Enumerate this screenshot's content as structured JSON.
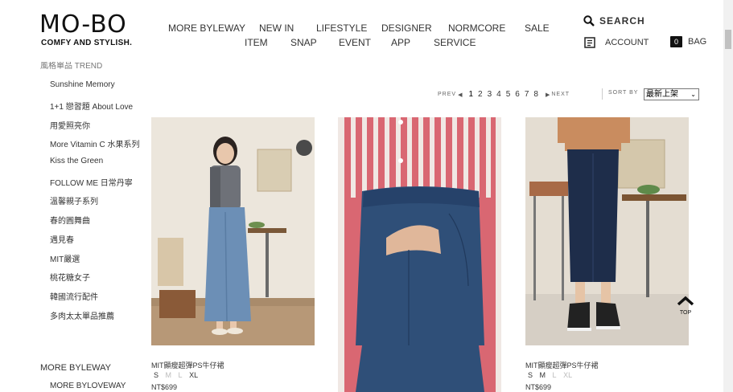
{
  "brand": {
    "logo": "MO-BO",
    "tagline": "COMFY AND STYLISH."
  },
  "nav": {
    "row1": [
      "MORE BYLEWAY",
      "NEW IN",
      "LIFESTYLE",
      "DESIGNER",
      "NORMCORE",
      "SALE"
    ],
    "row2": [
      "ITEM",
      "SNAP",
      "EVENT",
      "APP",
      "SERVICE"
    ]
  },
  "utility": {
    "search": "SEARCH",
    "account": "ACCOUNT",
    "bag": "BAG",
    "bag_count": "0"
  },
  "sidebar": {
    "heading": "風格單品 TREND",
    "items": [
      "Sunshine Memory",
      "1+1 戀習題 About Love",
      "用愛照亮你",
      "More Vitamin C 水果系列",
      "Kiss the Green",
      "FOLLOW ME 日常丹寧",
      "溫馨親子系列",
      "春的圓舞曲",
      "遇見春",
      "MIT嚴選",
      "桃花糖女子",
      "韓國流行配件",
      "多肉太太單品推薦"
    ],
    "section2_title": "MORE BYLEWAY",
    "section2_item": "MORE BYLOVEWAY"
  },
  "pager": {
    "prev": "PREV",
    "next": "NEXT",
    "pages": [
      "1",
      "2",
      "3",
      "4",
      "5",
      "6",
      "7",
      "8"
    ],
    "current": "1"
  },
  "sort": {
    "label": "SORT BY",
    "value": "最新上架"
  },
  "products": [
    {
      "name": "MIT顯瘦超彈PS牛仔裙",
      "sizes": [
        {
          "s": "S",
          "avail": true
        },
        {
          "s": "M",
          "avail": false
        },
        {
          "s": "L",
          "avail": false
        },
        {
          "s": "XL",
          "avail": true
        }
      ],
      "price": "NT$699"
    },
    {
      "name": "",
      "sizes": [],
      "price": ""
    },
    {
      "name": "MIT顯瘦超彈PS牛仔裙",
      "sizes": [
        {
          "s": "S",
          "avail": true
        },
        {
          "s": "M",
          "avail": true
        },
        {
          "s": "L",
          "avail": false
        },
        {
          "s": "XL",
          "avail": false
        }
      ],
      "price": "NT$699"
    }
  ],
  "top_button": "TOP",
  "colors": {
    "text": "#333333",
    "unavailable": "#bbbbbb",
    "denim": "#2f4d72",
    "stripe_red": "#c8505a"
  }
}
